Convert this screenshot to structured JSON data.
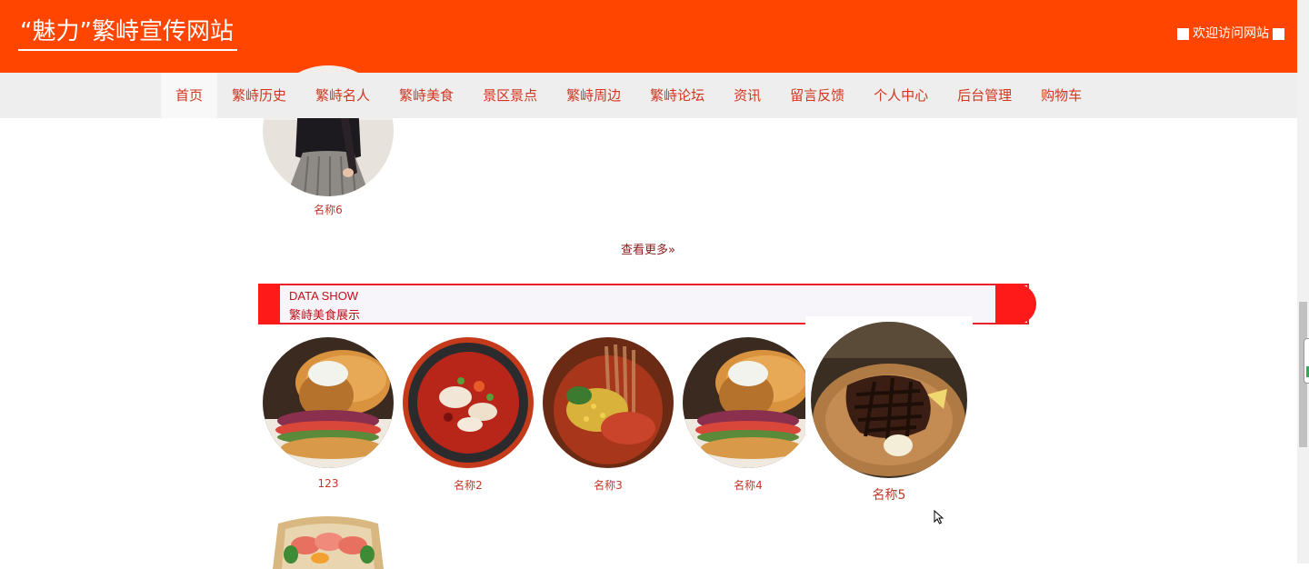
{
  "header": {
    "site_title": "“魅力”繁峙宣传网站",
    "welcome": "欢迎访问网站"
  },
  "nav": {
    "items": [
      {
        "label": "首页",
        "active": true
      },
      {
        "label": "繁峙历史"
      },
      {
        "label": "繁峙名人"
      },
      {
        "label": "繁峙美食"
      },
      {
        "label": "景区景点"
      },
      {
        "label": "繁峙周边"
      },
      {
        "label": "繁峙论坛"
      },
      {
        "label": "资讯"
      },
      {
        "label": "留言反馈"
      },
      {
        "label": "个人中心"
      },
      {
        "label": "后台管理"
      },
      {
        "label": "购物车"
      }
    ]
  },
  "people": {
    "last_item_label": "名称6",
    "view_more": "查看更多"
  },
  "food_section": {
    "title_en": "DATA SHOW",
    "title_cn": "繁峙美食展示",
    "items": [
      {
        "label": "123",
        "image": "burger-photo"
      },
      {
        "label": "名称2",
        "image": "spicy-fish-photo"
      },
      {
        "label": "名称3",
        "image": "noodles-photo"
      },
      {
        "label": "名称4",
        "image": "burger-photo"
      },
      {
        "label": "名称5",
        "image": "steak-photo"
      },
      {
        "label": "",
        "image": "sashimi-photo"
      }
    ]
  },
  "colors": {
    "header_bg": "#ff4500",
    "nav_bg": "#eeeeee",
    "nav_text": "#d3361f",
    "accent_red": "#ff1a1a"
  }
}
